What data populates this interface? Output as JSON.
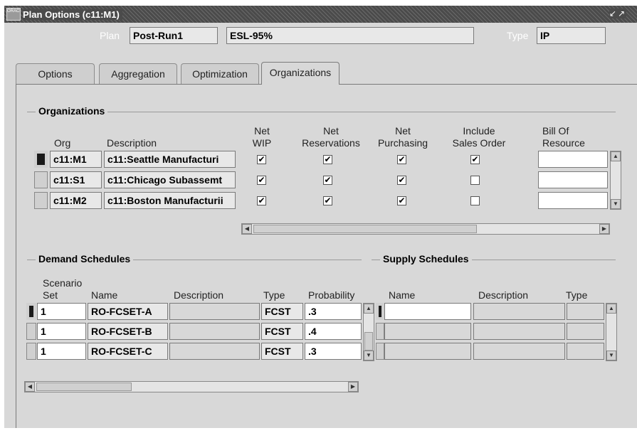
{
  "window": {
    "title": "Plan Options (c11:M1)",
    "icon": "oracle-forms-icon"
  },
  "header": {
    "plan_label": "Plan",
    "plan_value": "Post-Run1",
    "plan_description": "ESL-95%",
    "type_label": "Type",
    "type_value": "IP"
  },
  "tabs": [
    {
      "label": "Options"
    },
    {
      "label": "Aggregation"
    },
    {
      "label": "Optimization"
    },
    {
      "label": "Organizations",
      "active": true
    }
  ],
  "organizations": {
    "section_title": "Organizations",
    "columns": {
      "org": "Org",
      "description": "Description",
      "net_wip": [
        "Net",
        "WIP"
      ],
      "net_reservations": [
        "Net",
        "Reservations"
      ],
      "net_purchasing": [
        "Net",
        "Purchasing"
      ],
      "include_sales_order": [
        "Include",
        "Sales Order"
      ],
      "bill_of_resource": [
        "Bill Of",
        "Resource"
      ]
    },
    "rows": [
      {
        "org": "c11:M1",
        "description": "c11:Seattle Manufacturi",
        "net_wip": true,
        "net_reservations": true,
        "net_purchasing": true,
        "include_sales_order": true,
        "bill_of_resource": ""
      },
      {
        "org": "c11:S1",
        "description": "c11:Chicago Subassemt",
        "net_wip": true,
        "net_reservations": true,
        "net_purchasing": true,
        "include_sales_order": false,
        "bill_of_resource": ""
      },
      {
        "org": "c11:M2",
        "description": "c11:Boston Manufacturii",
        "net_wip": true,
        "net_reservations": true,
        "net_purchasing": true,
        "include_sales_order": false,
        "bill_of_resource": ""
      }
    ]
  },
  "demand_schedules": {
    "section_title": "Demand Schedules",
    "columns": {
      "scenario_set": [
        "Scenario",
        "Set"
      ],
      "name": "Name",
      "description": "Description",
      "type": "Type",
      "probability": "Probability"
    },
    "rows": [
      {
        "scenario_set": "1",
        "name": "RO-FCSET-A",
        "description": "",
        "type": "FCST",
        "probability": ".3"
      },
      {
        "scenario_set": "1",
        "name": "RO-FCSET-B",
        "description": "",
        "type": "FCST",
        "probability": ".4"
      },
      {
        "scenario_set": "1",
        "name": "RO-FCSET-C",
        "description": "",
        "type": "FCST",
        "probability": ".3"
      }
    ]
  },
  "supply_schedules": {
    "section_title": "Supply Schedules",
    "columns": {
      "name": "Name",
      "description": "Description",
      "type": "Type"
    },
    "rows": [
      {
        "name": "",
        "description": "",
        "type": ""
      },
      {
        "name": "",
        "description": "",
        "type": ""
      },
      {
        "name": "",
        "description": "",
        "type": ""
      }
    ]
  },
  "colors": {
    "title_bar": "#4b4b4b",
    "panel": "#d8d8d8",
    "field": "#e8e8e8",
    "editable_field": "#ffffff"
  }
}
